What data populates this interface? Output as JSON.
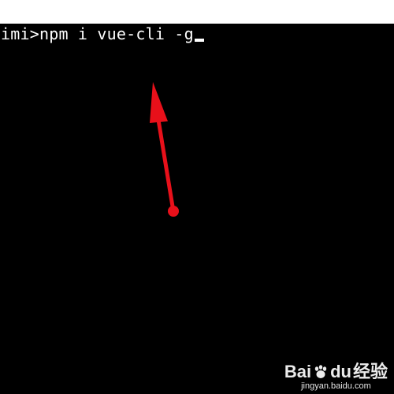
{
  "terminal": {
    "prompt": "imi>",
    "command": "npm i vue-cli -g"
  },
  "annotation": {
    "arrow_color": "#e8101a"
  },
  "watermark": {
    "logo_latin": "Bai",
    "logo_du": "du",
    "logo_cn": "经验",
    "site": "jingyan.baidu.com"
  },
  "colors": {
    "terminal_bg": "#000000",
    "terminal_text": "#ffffff",
    "top_strip": "#ffffff"
  }
}
